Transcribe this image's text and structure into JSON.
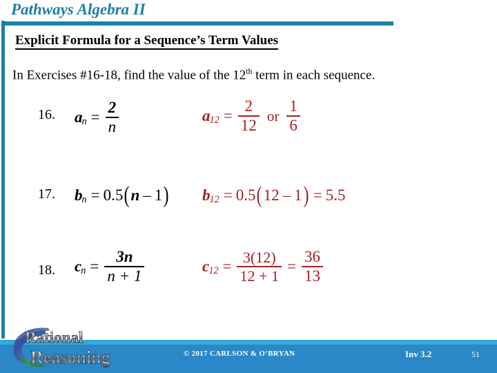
{
  "header": {
    "title": "Pathways Algebra II",
    "accent_color": "#1B7FA8"
  },
  "subtitle": "Explicit Formula for a Sequence’s Term Values",
  "instruction": {
    "before": "In Exercises #16-18, find the value of the 12",
    "superscript": "th",
    "after": " term in each sequence."
  },
  "exercises": [
    {
      "number": "16.",
      "formula": {
        "variable": "a",
        "subscript": "n",
        "equals": "=",
        "numerator": "2",
        "denominator": "n"
      },
      "answer": {
        "variable": "a",
        "subscript": "12",
        "equals": "=",
        "numerator": "2",
        "denominator": "12",
        "conjunction": "or",
        "alt_numerator": "1",
        "alt_denominator": "6"
      }
    },
    {
      "number": "17.",
      "formula": {
        "variable": "b",
        "subscript": "n",
        "equals": "=",
        "coefficient": "0.5",
        "open": "(",
        "inner_var": "n",
        "minus": "–",
        "inner_num": "1",
        "close": ")"
      },
      "answer": {
        "variable": "b",
        "subscript": "12",
        "equals": "=",
        "coefficient": "0.5",
        "open": "(",
        "inner_first": "12",
        "minus": "–",
        "inner_num": "1",
        "close": ")",
        "equals2": "=",
        "result": "5.5"
      }
    },
    {
      "number": "18.",
      "formula": {
        "variable": "c",
        "subscript": "n",
        "equals": "=",
        "numerator": "3n",
        "denominator": "n + 1"
      },
      "answer": {
        "variable": "c",
        "subscript": "12",
        "equals": "=",
        "numerator": "3(12)",
        "denominator": "12 + 1",
        "equals2": "=",
        "result_numerator": "36",
        "result_denominator": "13"
      }
    }
  ],
  "footer": {
    "copyright": "© 2017 CARLSON & O’BRYAN",
    "investigation": "Inv 3.2",
    "page_number": "51",
    "logo_line1": "Rational",
    "logo_line2": "Reasoning",
    "background_color": "#2A87C8",
    "band_color": "#34A9DC"
  },
  "answer_color": "#A41E22"
}
